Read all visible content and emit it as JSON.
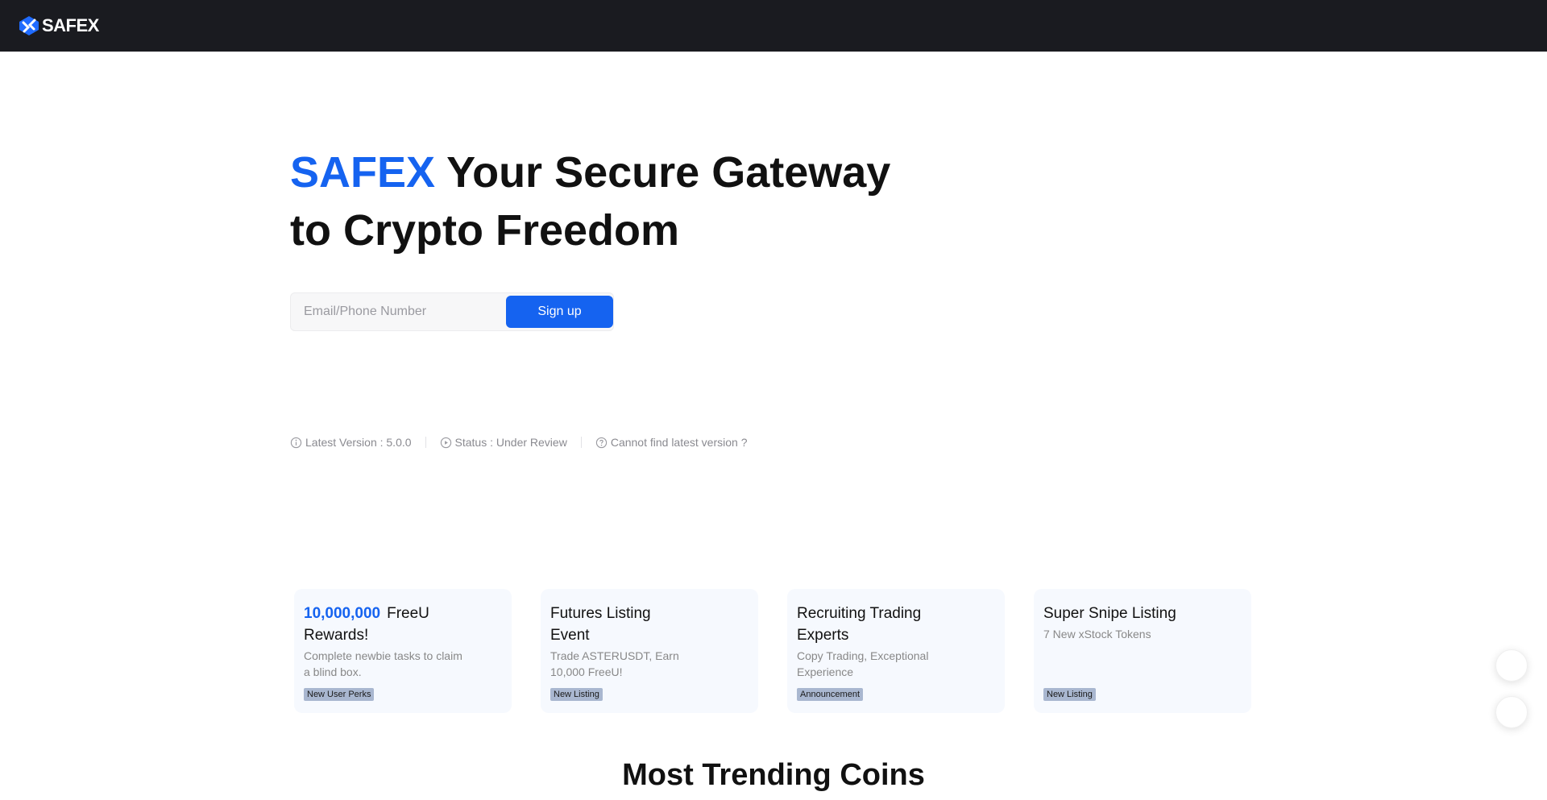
{
  "header": {
    "logo_text": "SAFEX",
    "logo_icon": "safex-logo-icon",
    "background_color": "#1a1b20"
  },
  "hero": {
    "brand": "SAFEX",
    "title_rest": "Your Secure Gateway to Crypto Freedom",
    "accent_color": "#1563f0"
  },
  "signup": {
    "placeholder": "Email/Phone Number",
    "button_label": "Sign up"
  },
  "version_info": {
    "latest_version": "Latest Version : 5.0.0",
    "latest_version_icon": "info-circle-icon",
    "status": "Status : Under Review",
    "status_icon": "play-circle-icon",
    "cannot_find": "Cannot find latest version ?",
    "cannot_find_icon": "question-circle-icon"
  },
  "cards": [
    {
      "highlight": "10,000,000",
      "title": "FreeU Rewards!",
      "description": "Complete newbie tasks to claim a blind box.",
      "badge": "New User Perks"
    },
    {
      "highlight": "",
      "title": "Futures Listing Event",
      "description": "Trade ASTERUSDT, Earn 10,000 FreeU!",
      "badge": "New Listing"
    },
    {
      "highlight": "",
      "title": "Recruiting Trading Experts",
      "description": "Copy Trading, Exceptional Experience",
      "badge": "Announcement"
    },
    {
      "highlight": "",
      "title": "Super Snipe Listing",
      "description": "7 New xStock Tokens",
      "badge": "New Listing"
    }
  ],
  "trending": {
    "title": "Most Trending Coins"
  },
  "floating_buttons": [
    "support-button",
    "scroll-button"
  ]
}
